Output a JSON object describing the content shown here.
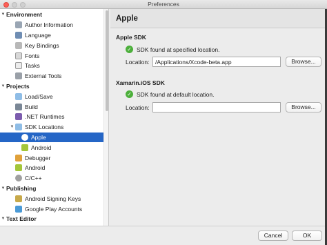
{
  "window": {
    "title": "Preferences"
  },
  "sidebar": {
    "rows": [
      {
        "label": "Environment",
        "type": "section"
      },
      {
        "label": "Author Information",
        "icon": "author-icon"
      },
      {
        "label": "Language",
        "icon": "language-icon"
      },
      {
        "label": "Key Bindings",
        "icon": "keyboard-icon"
      },
      {
        "label": "Fonts",
        "icon": "fonts-icon"
      },
      {
        "label": "Tasks",
        "icon": "tasks-icon"
      },
      {
        "label": "External Tools",
        "icon": "tools-icon"
      },
      {
        "label": "Projects",
        "type": "section"
      },
      {
        "label": "Load/Save",
        "icon": "folder-icon"
      },
      {
        "label": "Build",
        "icon": "build-icon"
      },
      {
        "label": ".NET Runtimes",
        "icon": "runtime-icon"
      },
      {
        "label": "SDK Locations",
        "icon": "folder-icon"
      },
      {
        "label": "Apple",
        "icon": "apple-icon"
      },
      {
        "label": "Android",
        "icon": "android-icon"
      },
      {
        "label": "Debugger",
        "icon": "debugger-icon"
      },
      {
        "label": "Android",
        "icon": "android-icon"
      },
      {
        "label": "C/C++",
        "icon": "gear-icon"
      },
      {
        "label": "Publishing",
        "type": "section"
      },
      {
        "label": "Android Signing Keys",
        "icon": "key-icon"
      },
      {
        "label": "Google Play Accounts",
        "icon": "play-icon"
      },
      {
        "label": "Text Editor",
        "type": "section"
      }
    ]
  },
  "content": {
    "title": "Apple",
    "apple_sdk": {
      "heading": "Apple SDK",
      "status": "SDK found at specified location.",
      "location_label": "Location:",
      "location_value": "/Applications/Xcode-beta.app",
      "browse_label": "Browse..."
    },
    "xamarin_sdk": {
      "heading": "Xamarin.iOS SDK",
      "status": "SDK found at default location.",
      "location_label": "Location:",
      "location_value": "",
      "browse_label": "Browse..."
    }
  },
  "footer": {
    "cancel_label": "Cancel",
    "ok_label": "OK"
  },
  "colors": {
    "selection": "#2566c6",
    "success": "#4caf3b"
  }
}
